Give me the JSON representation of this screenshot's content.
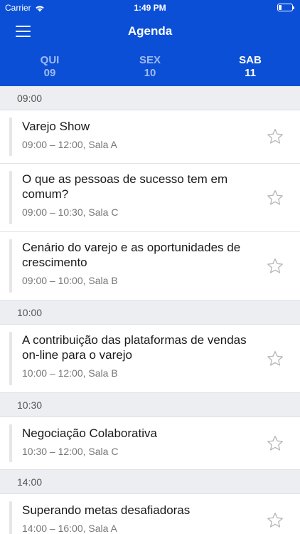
{
  "status": {
    "carrier": "Carrier",
    "time": "1:49 PM",
    "battery_level": 0.2
  },
  "nav": {
    "title": "Agenda"
  },
  "days": [
    {
      "label": "QUI",
      "date": "09"
    },
    {
      "label": "SEX",
      "date": "10"
    },
    {
      "label": "SAB",
      "date": "11",
      "active": true
    }
  ],
  "sections": [
    {
      "time": "09:00",
      "items": [
        {
          "title": "Varejo Show",
          "time": "09:00 – 12:00,",
          "room": "Sala A"
        },
        {
          "title": "O que as pessoas de sucesso tem em comum?",
          "time": "09:00 – 10:30,",
          "room": "Sala C"
        },
        {
          "title": "Cenário do varejo e as oportunidades de crescimento",
          "time": "09:00 – 10:00,",
          "room": "Sala B"
        }
      ]
    },
    {
      "time": "10:00",
      "items": [
        {
          "title": "A contribuição das plataformas de vendas on-line para o varejo",
          "time": "10:00 – 12:00,",
          "room": "Sala B"
        }
      ]
    },
    {
      "time": "10:30",
      "items": [
        {
          "title": "Negociação Colaborativa",
          "time": "10:30 – 12:00,",
          "room": "Sala C"
        }
      ]
    },
    {
      "time": "14:00",
      "items": [
        {
          "title": "Superando metas desafiadoras",
          "time": "14:00 – 16:00,",
          "room": "Sala A"
        }
      ]
    }
  ],
  "colors": {
    "header": "#0b4fd6",
    "day_inactive": "#9fbaf0",
    "section_bg": "#eceef1"
  },
  "icons": {
    "menu": "hamburger-icon",
    "favorite": "star-outline-icon",
    "wifi": "wifi-icon",
    "battery": "battery-icon"
  }
}
